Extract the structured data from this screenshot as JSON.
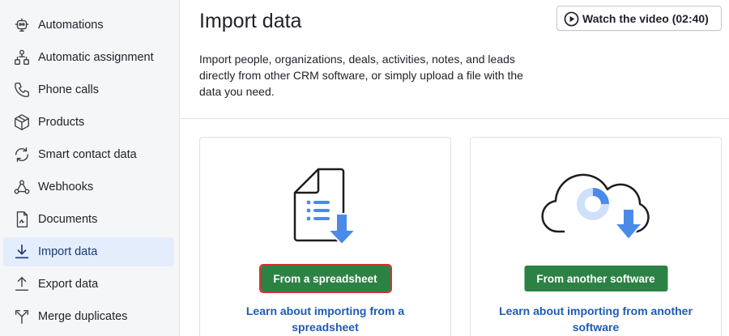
{
  "sidebar": {
    "items": [
      {
        "label": "Automations",
        "icon": "automations-icon"
      },
      {
        "label": "Automatic assignment",
        "icon": "assignment-icon"
      },
      {
        "label": "Phone calls",
        "icon": "phone-icon"
      },
      {
        "label": "Products",
        "icon": "box-icon"
      },
      {
        "label": "Smart contact data",
        "icon": "sync-icon"
      },
      {
        "label": "Webhooks",
        "icon": "webhook-icon"
      },
      {
        "label": "Documents",
        "icon": "document-icon"
      },
      {
        "label": "Import data",
        "icon": "download-icon",
        "active": true
      },
      {
        "label": "Export data",
        "icon": "upload-icon"
      },
      {
        "label": "Merge duplicates",
        "icon": "merge-icon"
      }
    ]
  },
  "main": {
    "title": "Import data",
    "video_button": "Watch the video (02:40)",
    "intro": "Import people, organizations, deals, activities, notes, and leads directly from other CRM software, or simply upload a file with the data you need.",
    "cards": [
      {
        "button": "From a spreadsheet",
        "link": "Learn about importing from a spreadsheet"
      },
      {
        "button": "From another software",
        "link": "Learn about importing from another software"
      }
    ]
  },
  "colors": {
    "accent_green": "#2b8244",
    "link_blue": "#1d5bb5",
    "icon_blue": "#4a8bea",
    "highlight_red": "#d6312f",
    "active_nav_bg": "#e4edfc"
  }
}
